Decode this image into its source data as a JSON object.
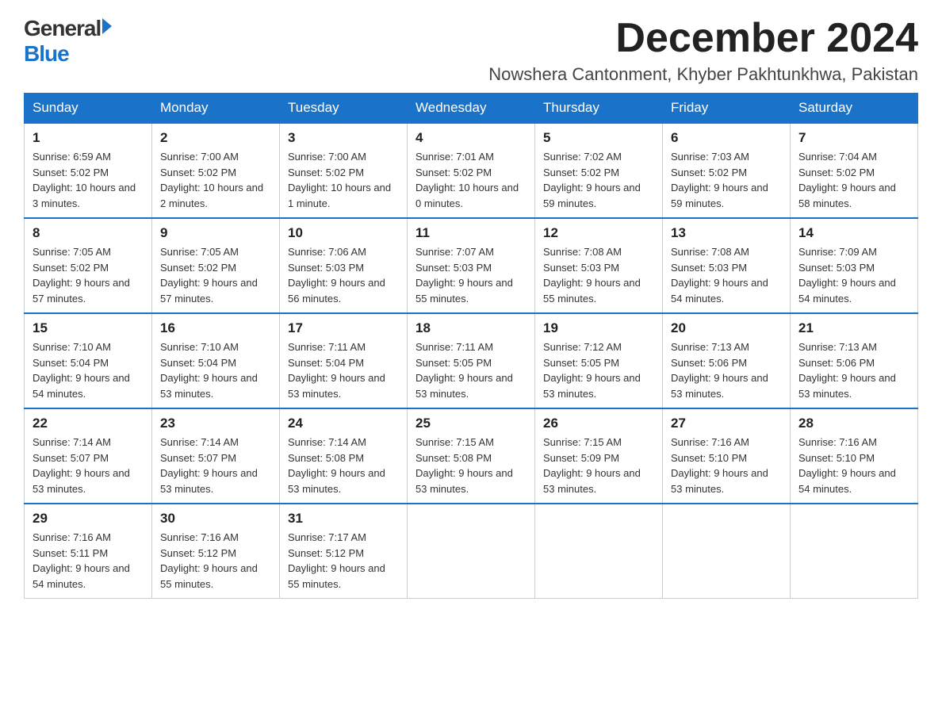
{
  "header": {
    "logo_general": "General",
    "logo_blue": "Blue",
    "month_year": "December 2024",
    "location": "Nowshera Cantonment, Khyber Pakhtunkhwa, Pakistan"
  },
  "days_of_week": [
    "Sunday",
    "Monday",
    "Tuesday",
    "Wednesday",
    "Thursday",
    "Friday",
    "Saturday"
  ],
  "weeks": [
    [
      {
        "day": "1",
        "sunrise": "6:59 AM",
        "sunset": "5:02 PM",
        "daylight": "10 hours and 3 minutes."
      },
      {
        "day": "2",
        "sunrise": "7:00 AM",
        "sunset": "5:02 PM",
        "daylight": "10 hours and 2 minutes."
      },
      {
        "day": "3",
        "sunrise": "7:00 AM",
        "sunset": "5:02 PM",
        "daylight": "10 hours and 1 minute."
      },
      {
        "day": "4",
        "sunrise": "7:01 AM",
        "sunset": "5:02 PM",
        "daylight": "10 hours and 0 minutes."
      },
      {
        "day": "5",
        "sunrise": "7:02 AM",
        "sunset": "5:02 PM",
        "daylight": "9 hours and 59 minutes."
      },
      {
        "day": "6",
        "sunrise": "7:03 AM",
        "sunset": "5:02 PM",
        "daylight": "9 hours and 59 minutes."
      },
      {
        "day": "7",
        "sunrise": "7:04 AM",
        "sunset": "5:02 PM",
        "daylight": "9 hours and 58 minutes."
      }
    ],
    [
      {
        "day": "8",
        "sunrise": "7:05 AM",
        "sunset": "5:02 PM",
        "daylight": "9 hours and 57 minutes."
      },
      {
        "day": "9",
        "sunrise": "7:05 AM",
        "sunset": "5:02 PM",
        "daylight": "9 hours and 57 minutes."
      },
      {
        "day": "10",
        "sunrise": "7:06 AM",
        "sunset": "5:03 PM",
        "daylight": "9 hours and 56 minutes."
      },
      {
        "day": "11",
        "sunrise": "7:07 AM",
        "sunset": "5:03 PM",
        "daylight": "9 hours and 55 minutes."
      },
      {
        "day": "12",
        "sunrise": "7:08 AM",
        "sunset": "5:03 PM",
        "daylight": "9 hours and 55 minutes."
      },
      {
        "day": "13",
        "sunrise": "7:08 AM",
        "sunset": "5:03 PM",
        "daylight": "9 hours and 54 minutes."
      },
      {
        "day": "14",
        "sunrise": "7:09 AM",
        "sunset": "5:03 PM",
        "daylight": "9 hours and 54 minutes."
      }
    ],
    [
      {
        "day": "15",
        "sunrise": "7:10 AM",
        "sunset": "5:04 PM",
        "daylight": "9 hours and 54 minutes."
      },
      {
        "day": "16",
        "sunrise": "7:10 AM",
        "sunset": "5:04 PM",
        "daylight": "9 hours and 53 minutes."
      },
      {
        "day": "17",
        "sunrise": "7:11 AM",
        "sunset": "5:04 PM",
        "daylight": "9 hours and 53 minutes."
      },
      {
        "day": "18",
        "sunrise": "7:11 AM",
        "sunset": "5:05 PM",
        "daylight": "9 hours and 53 minutes."
      },
      {
        "day": "19",
        "sunrise": "7:12 AM",
        "sunset": "5:05 PM",
        "daylight": "9 hours and 53 minutes."
      },
      {
        "day": "20",
        "sunrise": "7:13 AM",
        "sunset": "5:06 PM",
        "daylight": "9 hours and 53 minutes."
      },
      {
        "day": "21",
        "sunrise": "7:13 AM",
        "sunset": "5:06 PM",
        "daylight": "9 hours and 53 minutes."
      }
    ],
    [
      {
        "day": "22",
        "sunrise": "7:14 AM",
        "sunset": "5:07 PM",
        "daylight": "9 hours and 53 minutes."
      },
      {
        "day": "23",
        "sunrise": "7:14 AM",
        "sunset": "5:07 PM",
        "daylight": "9 hours and 53 minutes."
      },
      {
        "day": "24",
        "sunrise": "7:14 AM",
        "sunset": "5:08 PM",
        "daylight": "9 hours and 53 minutes."
      },
      {
        "day": "25",
        "sunrise": "7:15 AM",
        "sunset": "5:08 PM",
        "daylight": "9 hours and 53 minutes."
      },
      {
        "day": "26",
        "sunrise": "7:15 AM",
        "sunset": "5:09 PM",
        "daylight": "9 hours and 53 minutes."
      },
      {
        "day": "27",
        "sunrise": "7:16 AM",
        "sunset": "5:10 PM",
        "daylight": "9 hours and 53 minutes."
      },
      {
        "day": "28",
        "sunrise": "7:16 AM",
        "sunset": "5:10 PM",
        "daylight": "9 hours and 54 minutes."
      }
    ],
    [
      {
        "day": "29",
        "sunrise": "7:16 AM",
        "sunset": "5:11 PM",
        "daylight": "9 hours and 54 minutes."
      },
      {
        "day": "30",
        "sunrise": "7:16 AM",
        "sunset": "5:12 PM",
        "daylight": "9 hours and 55 minutes."
      },
      {
        "day": "31",
        "sunrise": "7:17 AM",
        "sunset": "5:12 PM",
        "daylight": "9 hours and 55 minutes."
      },
      null,
      null,
      null,
      null
    ]
  ]
}
